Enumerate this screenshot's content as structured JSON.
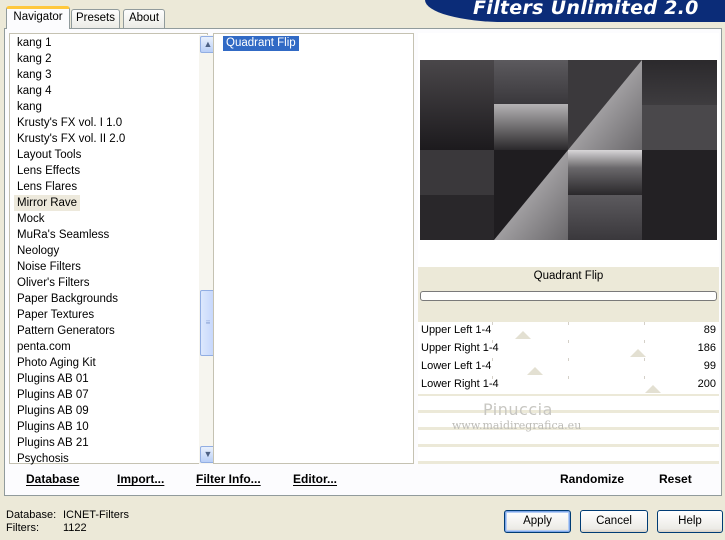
{
  "tabs": [
    "Navigator",
    "Presets",
    "About"
  ],
  "banner": {
    "title": "Filters Unlimited 2.0"
  },
  "categories": [
    "kang 1",
    "kang 2",
    "kang 3",
    "kang 4",
    "kang",
    "Krusty's FX vol. I 1.0",
    "Krusty's FX vol. II 2.0",
    "Layout Tools",
    "Lens Effects",
    "Lens Flares",
    "Mirror Rave",
    "Mock",
    "MuRa's Seamless",
    "Neology",
    "Noise Filters",
    "Oliver's Filters",
    "Paper Backgrounds",
    "Paper Textures",
    "Pattern Generators",
    "penta.com",
    "Photo Aging Kit",
    "Plugins AB 01",
    "Plugins AB 07",
    "Plugins AB 09",
    "Plugins AB 10",
    "Plugins AB 21",
    "Psychosis"
  ],
  "selected_category": "Mirror Rave",
  "filters": [
    "Quadrant Flip"
  ],
  "preview": {
    "filter_name": "Quadrant Flip"
  },
  "params": [
    {
      "label": "Upper Left 1-4",
      "value": "89",
      "level": 0.35
    },
    {
      "label": "Upper Right 1-4",
      "value": "186",
      "level": 0.73
    },
    {
      "label": "Lower Left 1-4",
      "value": "99",
      "level": 0.39
    },
    {
      "label": "Lower Right 1-4",
      "value": "200",
      "level": 0.78
    }
  ],
  "watermark": {
    "line1": "Pinuccia",
    "line2": "www.maidiregrafica.eu"
  },
  "commands": {
    "database": "Database",
    "import": "Import...",
    "filter_info": "Filter Info...",
    "editor": "Editor...",
    "randomize": "Randomize",
    "reset": "Reset"
  },
  "status": {
    "database_label": "Database:",
    "database_value": "ICNET-Filters",
    "filters_label": "Filters:",
    "filters_value": "1122"
  },
  "buttons": {
    "apply": "Apply",
    "cancel": "Cancel",
    "help": "Help"
  }
}
